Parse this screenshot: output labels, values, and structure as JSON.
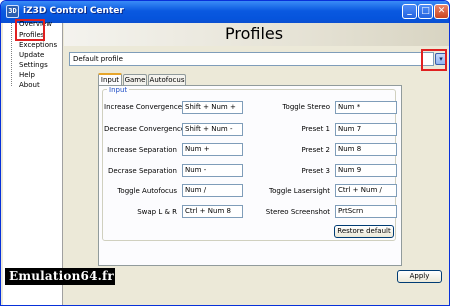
{
  "window": {
    "title": "iZ3D Control Center",
    "icon": "app-logo-icon"
  },
  "titlebar_buttons": {
    "minimize": "_",
    "maximize": "□",
    "close": "✕"
  },
  "sidebar": {
    "items": [
      {
        "label": "Overview"
      },
      {
        "label": "Profiles",
        "selected": true
      },
      {
        "label": "Exceptions"
      },
      {
        "label": "Update"
      },
      {
        "label": "Settings"
      },
      {
        "label": "Help"
      },
      {
        "label": "About"
      }
    ]
  },
  "main": {
    "title": "Profiles",
    "profile_select": {
      "value": "Default profile",
      "dropdown_glyph": "▾"
    },
    "tabs": [
      {
        "label": "Input",
        "active": true
      },
      {
        "label": "Game"
      },
      {
        "label": "Autofocus"
      }
    ],
    "group_label": "Input",
    "left_bindings": [
      {
        "label": "Increase Convergence",
        "value": "Shift + Num +"
      },
      {
        "label": "Decrease Convergence",
        "value": "Shift + Num -"
      },
      {
        "label": "Increase Separation",
        "value": "Num +"
      },
      {
        "label": "Decrase Separation",
        "value": "Num -"
      },
      {
        "label": "Toggle Autofocus",
        "value": "Num /"
      },
      {
        "label": "Swap L & R",
        "value": "Ctrl + Num 8"
      }
    ],
    "right_bindings": [
      {
        "label": "Toggle Stereo",
        "value": "Num *"
      },
      {
        "label": "Preset 1",
        "value": "Num 7"
      },
      {
        "label": "Preset 2",
        "value": "Num 8"
      },
      {
        "label": "Preset 3",
        "value": "Num 9"
      },
      {
        "label": "Toggle Lasersight",
        "value": "Ctrl + Num /"
      },
      {
        "label": "Stereo Screenshot",
        "value": "PrtScrn"
      }
    ],
    "restore_default_label": "Restore default",
    "apply_label": "Apply"
  },
  "watermark": "Emulation64.fr",
  "colors": {
    "title_bar": "#0a59e0",
    "highlight": "#e02020",
    "group_label": "#1f4fc6"
  }
}
